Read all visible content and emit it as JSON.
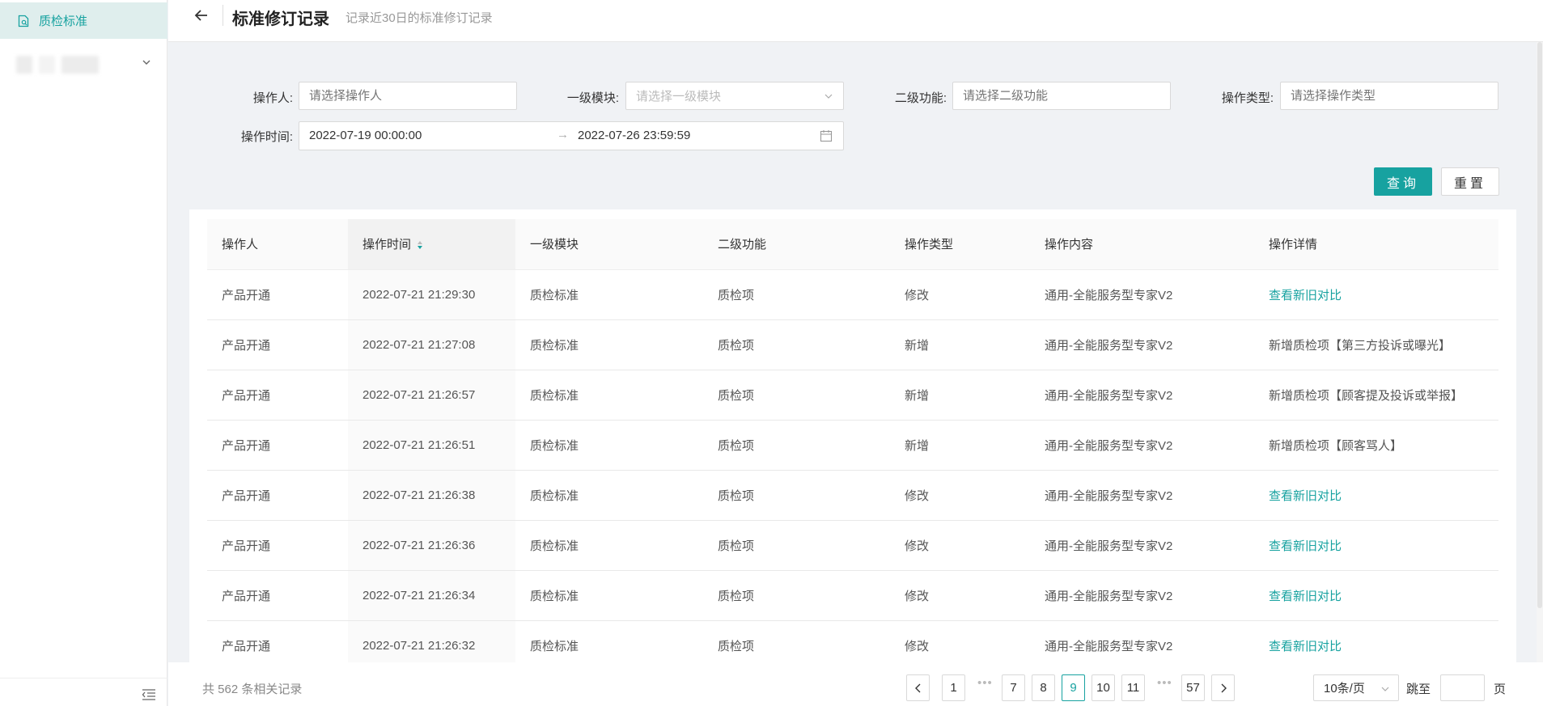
{
  "sidebar": {
    "active_item": "质检标准",
    "collapse_icon": "collapse-menu-icon"
  },
  "header": {
    "title": "标准修订记录",
    "subtitle": "记录近30日的标准修订记录"
  },
  "filters": {
    "operator": {
      "label": "操作人:",
      "placeholder": "请选择操作人"
    },
    "module": {
      "label": "一级模块:",
      "placeholder": "请选择一级模块"
    },
    "function": {
      "label": "二级功能:",
      "placeholder": "请选择二级功能"
    },
    "op_type": {
      "label": "操作类型:",
      "placeholder": "请选择操作类型"
    },
    "op_time": {
      "label": "操作时间:",
      "start": "2022-07-19 00:00:00",
      "separator": "→",
      "end": "2022-07-26 23:59:59"
    },
    "query_label": "查询",
    "reset_label": "重置"
  },
  "table": {
    "columns": [
      "操作人",
      "操作时间",
      "一级模块",
      "二级功能",
      "操作类型",
      "操作内容",
      "操作详情"
    ],
    "rows": [
      [
        "产品开通",
        "2022-07-21 21:29:30",
        "质检标准",
        "质检项",
        "修改",
        "通用-全能服务型专家V2",
        "查看新旧对比"
      ],
      [
        "产品开通",
        "2022-07-21 21:27:08",
        "质检标准",
        "质检项",
        "新增",
        "通用-全能服务型专家V2",
        "新增质检项【第三方投诉或曝光】"
      ],
      [
        "产品开通",
        "2022-07-21 21:26:57",
        "质检标准",
        "质检项",
        "新增",
        "通用-全能服务型专家V2",
        "新增质检项【顾客提及投诉或举报】"
      ],
      [
        "产品开通",
        "2022-07-21 21:26:51",
        "质检标准",
        "质检项",
        "新增",
        "通用-全能服务型专家V2",
        "新增质检项【顾客骂人】"
      ],
      [
        "产品开通",
        "2022-07-21 21:26:38",
        "质检标准",
        "质检项",
        "修改",
        "通用-全能服务型专家V2",
        "查看新旧对比"
      ],
      [
        "产品开通",
        "2022-07-21 21:26:36",
        "质检标准",
        "质检项",
        "修改",
        "通用-全能服务型专家V2",
        "查看新旧对比"
      ],
      [
        "产品开通",
        "2022-07-21 21:26:34",
        "质检标准",
        "质检项",
        "修改",
        "通用-全能服务型专家V2",
        "查看新旧对比"
      ],
      [
        "产品开通",
        "2022-07-21 21:26:32",
        "质检标准",
        "质检项",
        "修改",
        "通用-全能服务型专家V2",
        "查看新旧对比"
      ]
    ],
    "link_text": "查看新旧对比"
  },
  "pagination": {
    "total_text": "共 562 条相关记录",
    "pages": [
      "1",
      "7",
      "8",
      "9",
      "10",
      "11",
      "57"
    ],
    "current": "9",
    "ellipsis": "•••",
    "page_size": "10条/页",
    "jump_label": "跳至",
    "page_suffix": "页"
  },
  "colors": {
    "accent": "#17a2a0"
  }
}
